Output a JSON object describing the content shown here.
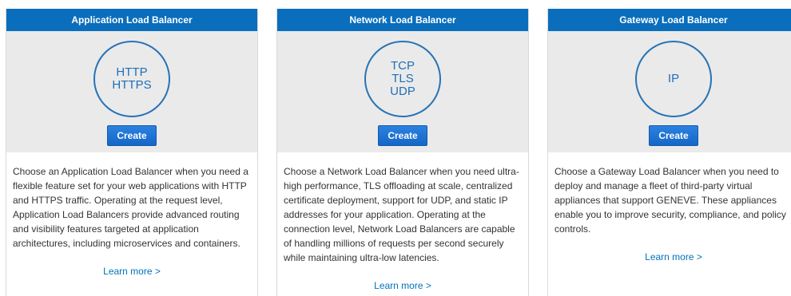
{
  "cards": [
    {
      "title": "Application Load Balancer",
      "protocols": [
        "HTTP",
        "HTTPS"
      ],
      "button": "Create",
      "description": "Choose an Application Load Balancer when you need a flexible feature set for your web applications with HTTP and HTTPS traffic. Operating at the request level, Application Load Balancers provide advanced routing and visibility features targeted at application architectures, including microservices and containers.",
      "link": "Learn more >"
    },
    {
      "title": "Network Load Balancer",
      "protocols": [
        "TCP",
        "TLS",
        "UDP"
      ],
      "button": "Create",
      "description": "Choose a Network Load Balancer when you need ultra-high performance, TLS offloading at scale, centralized certificate deployment, support for UDP, and static IP addresses for your application. Operating at the connection level, Network Load Balancers are capable of handling millions of requests per second securely while maintaining ultra-low latencies.",
      "link": "Learn more >"
    },
    {
      "title": "Gateway Load Balancer",
      "protocols": [
        "IP"
      ],
      "button": "Create",
      "description": "Choose a Gateway Load Balancer when you need to deploy and manage a fleet of third-party virtual appliances that support GENEVE. These appliances enable you to improve security, compliance, and policy controls.",
      "link": "Learn more >"
    }
  ],
  "colors": {
    "header": "#0a6ebd",
    "circle": "#2773b6",
    "button": "#1a6fd1",
    "link": "#0073bb",
    "visual_bg": "#eaeaea"
  }
}
